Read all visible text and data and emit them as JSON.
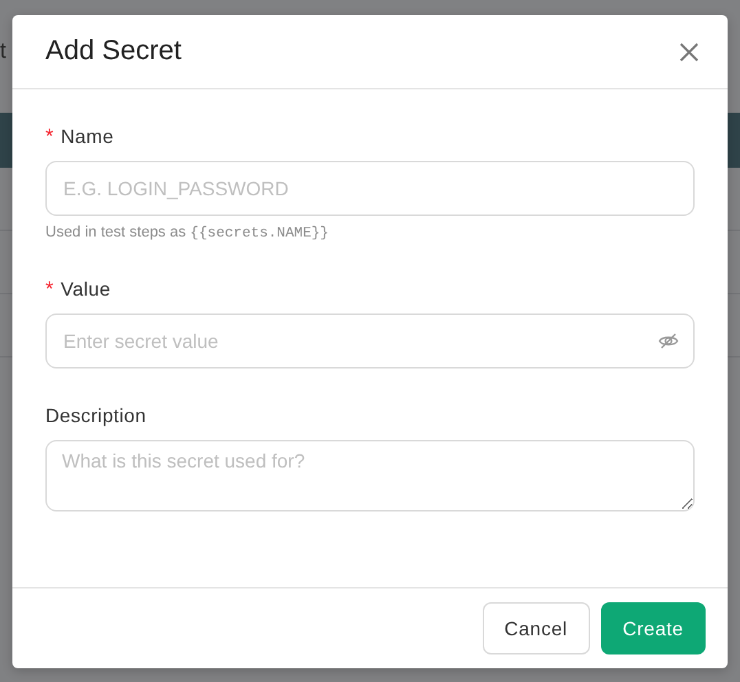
{
  "background": {
    "text": "t"
  },
  "dialog": {
    "title": "Add Secret",
    "fields": [
      {
        "kind": "input",
        "label": "Name",
        "required": true,
        "placeholder": "E.G. LOGIN_PASSWORD",
        "hint": "Used in test steps as",
        "hint_code": "{{secrets.NAME}}"
      },
      {
        "kind": "password",
        "label": "Value",
        "required": true,
        "placeholder": "Enter secret value"
      },
      {
        "kind": "textarea",
        "label": "Description",
        "required": false,
        "placeholder": "What is this secret used for?"
      }
    ],
    "required_mark": "*",
    "buttons": [
      {
        "kind": "secondary",
        "label": "Cancel"
      },
      {
        "kind": "primary",
        "label": "Create"
      }
    ]
  }
}
